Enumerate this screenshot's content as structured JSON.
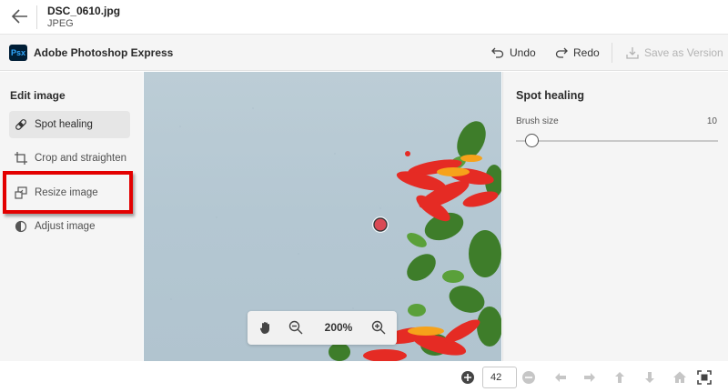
{
  "file": {
    "name": "DSC_0610.jpg",
    "type": "JPEG"
  },
  "app": {
    "logo_text": "Psx",
    "title": "Adobe Photoshop Express"
  },
  "toolbar": {
    "undo": "Undo",
    "redo": "Redo",
    "save": "Save as Version"
  },
  "left_panel": {
    "heading": "Edit image",
    "tools": [
      {
        "label": "Spot healing",
        "icon": "bandage-icon",
        "active": true
      },
      {
        "label": "Crop and straighten",
        "icon": "crop-icon",
        "active": false
      },
      {
        "label": "Resize image",
        "icon": "resize-icon",
        "active": false,
        "highlighted": true
      },
      {
        "label": "Adjust image",
        "icon": "adjust-icon",
        "active": false
      }
    ]
  },
  "canvas": {
    "zoom_level": "200%"
  },
  "right_panel": {
    "title": "Spot healing",
    "brush_label": "Brush size",
    "brush_value": "10",
    "brush_fraction": 0.05
  },
  "bottom": {
    "page_value": "42"
  },
  "colors": {
    "highlight": "#e30000",
    "accent": "#31a8ff",
    "logo_bg": "#001e36"
  }
}
